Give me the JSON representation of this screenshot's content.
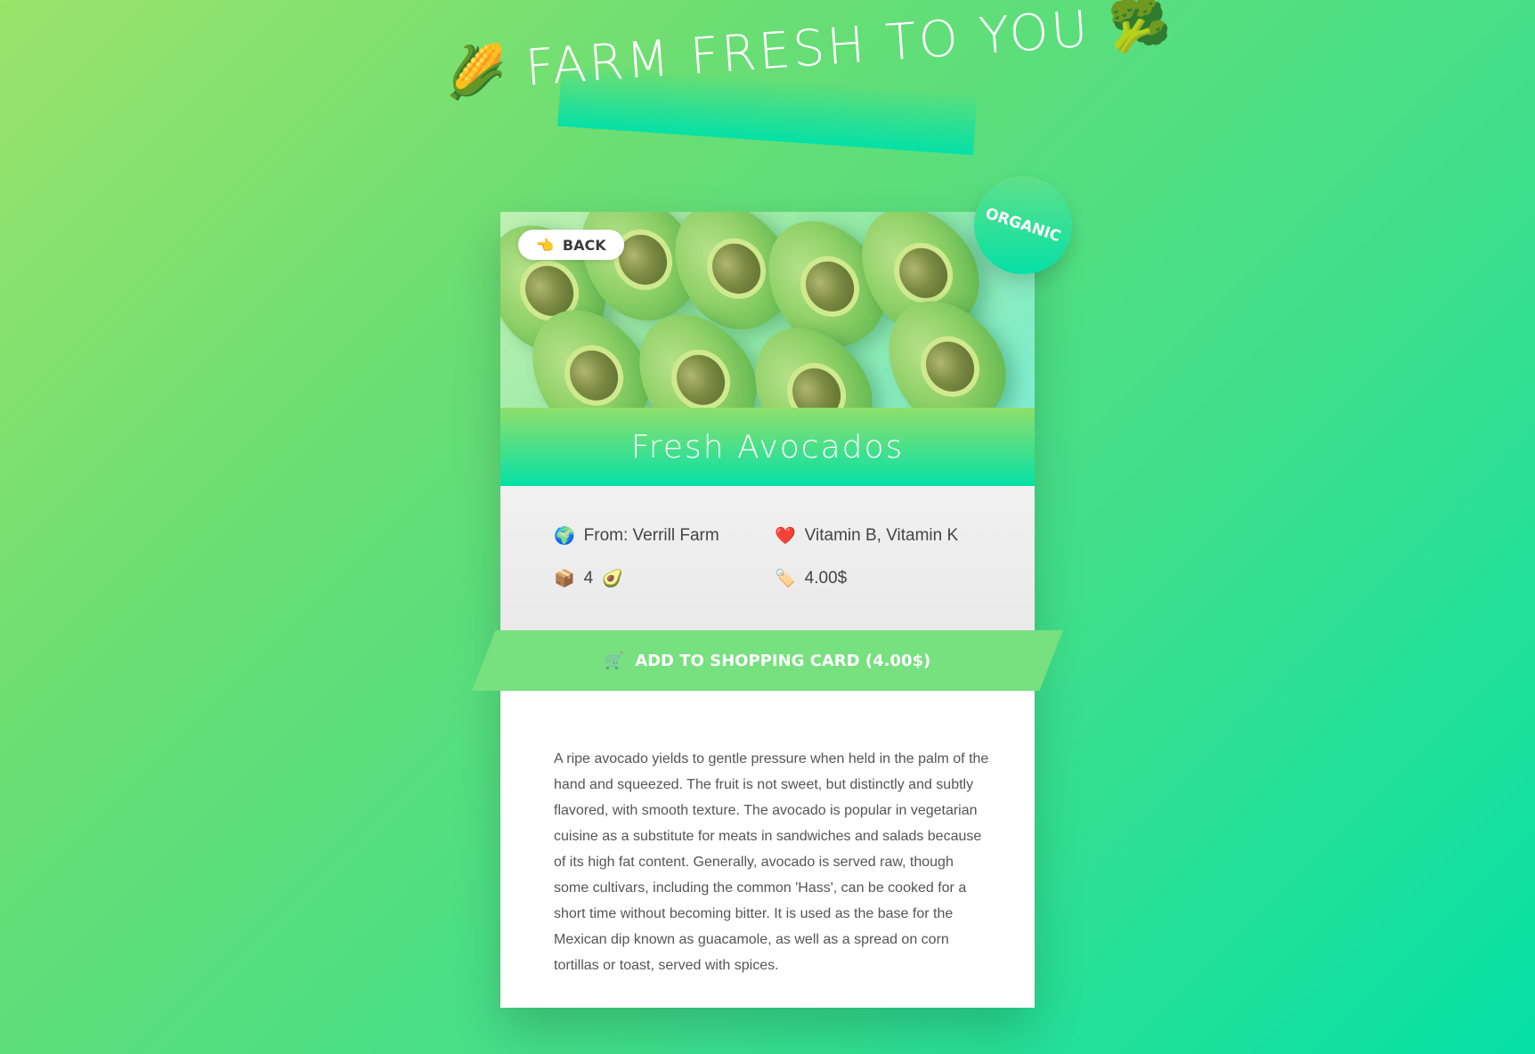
{
  "page": {
    "headline_emoji_left": "🌽",
    "headline": "FARM FRESH TO YOU",
    "headline_emoji_right": "🥦"
  },
  "product": {
    "back_emoji": "👈",
    "back_label": "BACK",
    "badge": "ORGANIC",
    "title": "Fresh Avocados",
    "info": {
      "origin_emoji": "🌍",
      "origin": "From: Verrill Farm",
      "vitamins_emoji": "❤️",
      "vitamins": "Vitamin B, Vitamin K",
      "quantity_emoji": "📦",
      "quantity": "4",
      "quantity_unit_emoji": "🥑",
      "price_emoji": "🏷️",
      "price": "4.00$"
    },
    "cta_emoji": "🛒",
    "cta_label": "ADD TO SHOPPING CARD (4.00$)",
    "description": "A ripe avocado yields to gentle pressure when held in the palm of the hand and squeezed. The fruit is not sweet, but distinctly and subtly flavored, with smooth texture. The avocado is popular in vegetarian cuisine as a substitute for meats in sandwiches and salads because of its high fat content. Generally, avocado is served raw, though some cultivars, including the common 'Hass', can be cooked for a short time without becoming bitter. It is used as the base for the Mexican dip known as guacamole, as well as a spread on corn tortillas or toast, served with spices."
  },
  "colors": {
    "bg_start": "#9be36b",
    "bg_end": "#05e0a6",
    "accent": "#77e07f"
  }
}
